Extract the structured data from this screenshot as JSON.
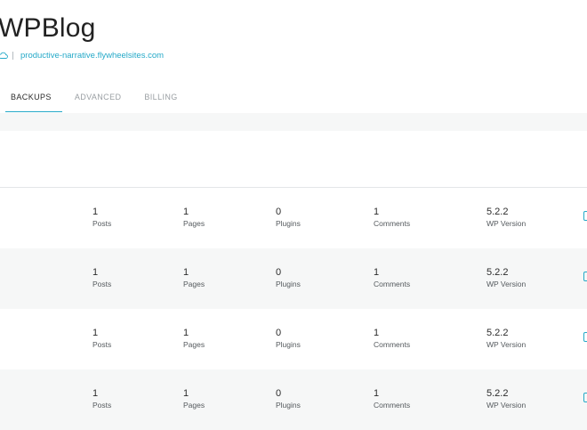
{
  "site": {
    "title": "WPBlog",
    "url": "productive-narrative.flywheelsites.com",
    "url_icon": "cloud-icon"
  },
  "tabs": [
    {
      "label": "BACKUPS",
      "active": true
    },
    {
      "label": "ADVANCED",
      "active": false
    },
    {
      "label": "BILLING",
      "active": false
    }
  ],
  "stat_labels": {
    "posts": "Posts",
    "pages": "Pages",
    "plugins": "Plugins",
    "comments": "Comments",
    "wp_version": "WP Version"
  },
  "backups": [
    {
      "posts": "1",
      "pages": "1",
      "plugins": "0",
      "comments": "1",
      "wp_version": "5.2.2"
    },
    {
      "posts": "1",
      "pages": "1",
      "plugins": "0",
      "comments": "1",
      "wp_version": "5.2.2"
    },
    {
      "posts": "1",
      "pages": "1",
      "plugins": "0",
      "comments": "1",
      "wp_version": "5.2.2"
    },
    {
      "posts": "1",
      "pages": "1",
      "plugins": "0",
      "comments": "1",
      "wp_version": "5.2.2"
    }
  ],
  "colors": {
    "accent": "#25a9c8",
    "row_alt": "#f6f7f7",
    "text": "#2b2b2b",
    "muted": "#9a9fa3"
  }
}
